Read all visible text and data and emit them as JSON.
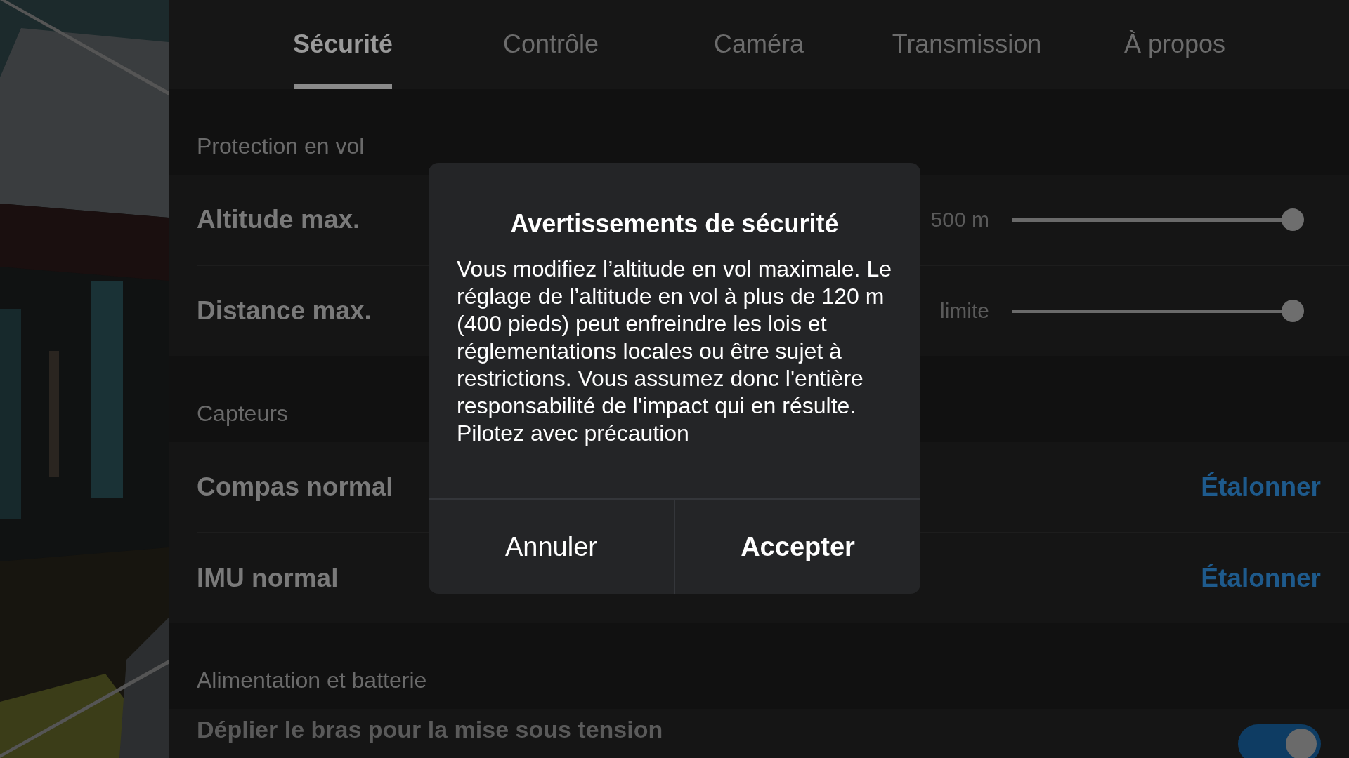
{
  "tabs": [
    {
      "label": "Sécurité",
      "selected": true
    },
    {
      "label": "Contrôle",
      "selected": false
    },
    {
      "label": "Caméra",
      "selected": false
    },
    {
      "label": "Transmission",
      "selected": false
    },
    {
      "label": "À propos",
      "selected": false
    }
  ],
  "sections": [
    {
      "title": "Protection en vol",
      "rows": [
        {
          "kind": "slider",
          "label": "Altitude max.",
          "value": "500 m",
          "level": 1
        },
        {
          "kind": "slider",
          "label": "Distance max.",
          "value": "limite",
          "level": 1
        }
      ]
    },
    {
      "title": "Capteurs",
      "rows": [
        {
          "kind": "action",
          "label": "Compas normal",
          "action": "Étalonner"
        },
        {
          "kind": "action",
          "label": "IMU normal",
          "action": "Étalonner"
        }
      ]
    },
    {
      "title": "Alimentation et batterie",
      "rows": [
        {
          "kind": "toggle",
          "label": "Déplier le bras pour la mise sous tension",
          "on": true
        }
      ]
    }
  ],
  "dialog": {
    "title": "Avertissements de sécurité",
    "message": "Vous modifiez l’altitude en vol maximale. Le réglage de l’altitude en vol à plus de 120 m (400 pieds) peut enfreindre les lois et réglementations locales ou être sujet à restrictions. Vous assumez donc l'entière responsabilité de l'impact qui en résulte. Pilotez avec précaution",
    "buttons": [
      {
        "label": "Annuler",
        "kind": "secondary"
      },
      {
        "label": "Accepter",
        "kind": "primary"
      }
    ]
  }
}
